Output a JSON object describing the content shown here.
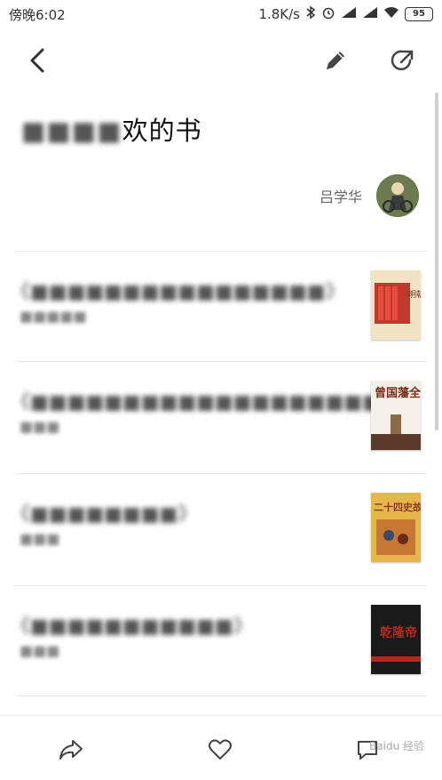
{
  "status": {
    "time": "傍晚6:02",
    "speed": "1.8K/s",
    "battery": "95"
  },
  "page": {
    "title_blurred": "■■■■",
    "title_visible": "欢的书",
    "author": "吕学华"
  },
  "books": [
    {
      "title": "《■■■■■■■■■■■■■■■■》",
      "author": "■■■■■"
    },
    {
      "title": "《■■■■■■■■■■■■■■■■■■■》",
      "author": "■■■"
    },
    {
      "title": "《■■■■■■■■》",
      "author": "■■■"
    },
    {
      "title": "《■■■■■■■■■■■》",
      "author": "■■■"
    }
  ],
  "covers": [
    {
      "label": "明朝那些事儿",
      "bg": "#f2e3c4",
      "accent": "#c0392b"
    },
    {
      "label": "曾国藩全传",
      "bg": "#f4f0e8",
      "accent": "#7a2e1a"
    },
    {
      "label": "二十四史故事",
      "bg": "#e7b64a",
      "accent": "#8a3b1a"
    },
    {
      "label": "乾隆帝",
      "bg": "#1a1a1a",
      "accent": "#b3261e"
    }
  ],
  "watermark": "Baidu 经验"
}
